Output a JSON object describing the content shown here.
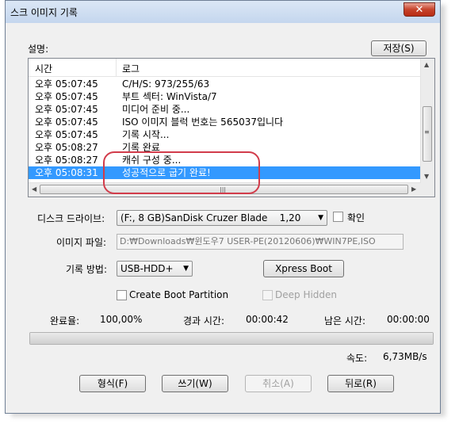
{
  "window": {
    "title": "스크 이미지 기록",
    "close_glyph": "✕"
  },
  "log": {
    "section_label": "설명:",
    "save_button": "저장(S)",
    "col_time": "시간",
    "col_log": "로그",
    "rows": [
      {
        "time": "오후 05:07:45",
        "msg": "C/H/S: 973/255/63"
      },
      {
        "time": "오후 05:07:45",
        "msg": "부트 섹터: WinVista/7"
      },
      {
        "time": "오후 05:07:45",
        "msg": "미디어 준비 중..."
      },
      {
        "time": "오후 05:07:45",
        "msg": "ISO 이미지 블럭 번호는 565037입니다"
      },
      {
        "time": "오후 05:07:45",
        "msg": "기록 시작..."
      },
      {
        "time": "오후 05:08:27",
        "msg": "기록 완료"
      },
      {
        "time": "오후 05:08:27",
        "msg": "캐쉬 구성 중..."
      },
      {
        "time": "오후 05:08:31",
        "msg": "성공적으로 굽기 완료!"
      }
    ],
    "selected_index": 7,
    "arrow_up": "▲",
    "arrow_down": "▼",
    "arrow_left": "◀",
    "arrow_right": "▶",
    "grip_v": "≡",
    "grip_h": "|||"
  },
  "form": {
    "drive_label": "디스크 드라이브:",
    "drive_value": "(F:, 8 GB)SanDisk Cruzer Blade    1,20",
    "verify_label": "확인",
    "image_label": "이미지 파일:",
    "image_value": "D:₩Downloads₩윈도우7 USER-PE(20120606)₩WIN7PE,ISO",
    "method_label": "기록 방법:",
    "method_value": "USB-HDD+",
    "xpress_button": "Xpress Boot",
    "create_boot_label": "Create Boot Partition",
    "deep_hidden_label": "Deep Hidden",
    "dropdown_glyph": "▼"
  },
  "status": {
    "done_label": "완료율:",
    "done_value": "100,00%",
    "elapsed_label": "경과 시간:",
    "elapsed_value": "00:00:42",
    "remaining_label": "남은 시간:",
    "remaining_value": "00:00:00",
    "progress": 1.0,
    "speed_label": "속도:",
    "speed_value": "6,73MB/s"
  },
  "buttons": {
    "format": "형식(F)",
    "write": "쓰기(W)",
    "cancel": "취소(A)",
    "back": "뒤로(R)"
  },
  "colors": {
    "selection": "#3399ff",
    "annotation": "#d23c4b"
  }
}
